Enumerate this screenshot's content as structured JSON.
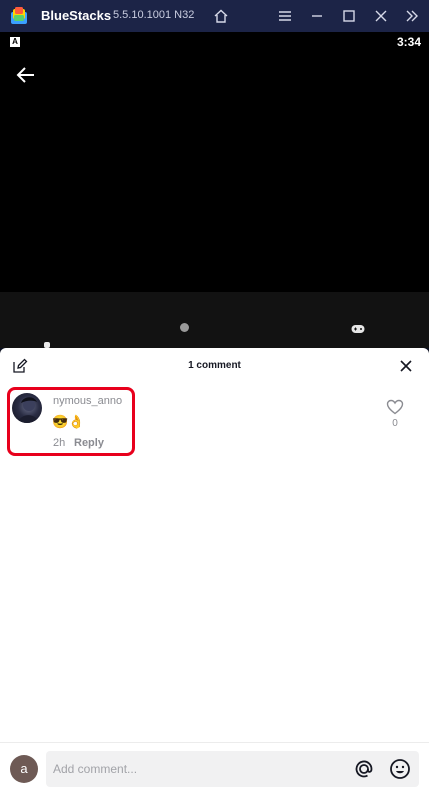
{
  "window": {
    "app_name": "BlueStacks",
    "version": "5.5.10.1001 N32"
  },
  "status_bar": {
    "indicator": "A",
    "time": "3:34"
  },
  "comments_panel": {
    "title": "1 comment",
    "comments": [
      {
        "username": "nymous_anno",
        "text": "😎👌",
        "time": "2h",
        "reply_label": "Reply",
        "likes": "0"
      }
    ]
  },
  "input": {
    "avatar_letter": "a",
    "placeholder": "Add comment..."
  },
  "colors": {
    "titlebar_bg": "#1c2447",
    "highlight_border": "#e8001c",
    "muted_text": "#8a8b91"
  },
  "icons": {
    "titlebar": [
      "home-icon",
      "menu-icon",
      "minimize-icon",
      "maximize-icon",
      "close-window-icon",
      "sidebar-toggle-icon"
    ],
    "panel": [
      "edit-icon",
      "close-icon",
      "heart-icon",
      "at-icon",
      "emoji-icon"
    ]
  }
}
